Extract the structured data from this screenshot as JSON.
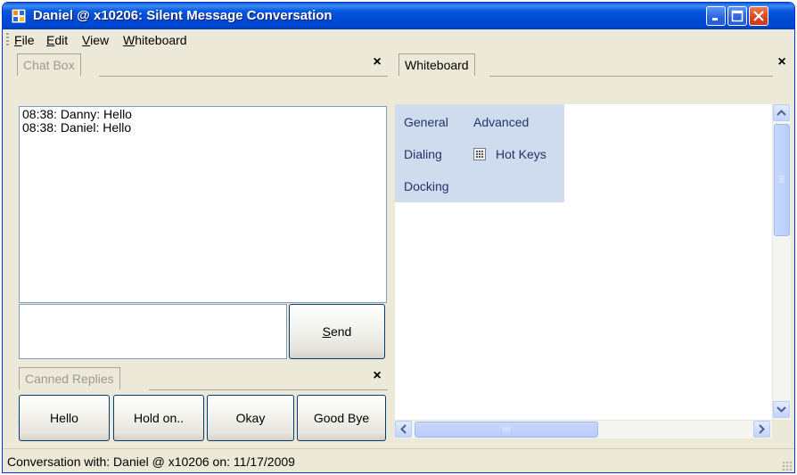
{
  "window": {
    "title": "Daniel @  x10206: Silent Message Conversation",
    "icons": {
      "app": "app-window-icon",
      "minimize": "minimize-icon",
      "maximize": "maximize-icon",
      "close": "close-icon"
    }
  },
  "menu": {
    "items": [
      {
        "label": "File",
        "accel": "F",
        "rest": "ile"
      },
      {
        "label": "Edit",
        "accel": "E",
        "rest": "dit"
      },
      {
        "label": "View",
        "accel": "V",
        "rest": "iew"
      },
      {
        "label": "Whiteboard",
        "accel": "W",
        "rest": "hiteboard"
      }
    ]
  },
  "chat_panel": {
    "tab_label": "Chat Box",
    "close_glyph": "×",
    "messages": [
      "08:38: Danny: Hello",
      "08:38: Daniel: Hello"
    ],
    "input_value": "",
    "send": {
      "accel": "S",
      "rest": "end",
      "label": "Send"
    }
  },
  "canned_panel": {
    "tab_label": "Canned Replies",
    "close_glyph": "×",
    "buttons": [
      "Hello",
      "Hold on..",
      "Okay",
      "Good Bye"
    ]
  },
  "whiteboard_panel": {
    "tab_label": "Whiteboard",
    "close_glyph": "×",
    "menu_items": {
      "general": "General",
      "advanced": "Advanced",
      "dialing": "Dialing",
      "hot_keys": "Hot Keys",
      "docking": "Docking"
    },
    "hot_keys_icon": "keypad-icon"
  },
  "status": {
    "text": "Conversation with: Daniel @  x10206 on: 11/17/2009"
  },
  "colors": {
    "title_bar": "#0049d4",
    "window_face": "#ece9d8",
    "menu_highlight": "#cfdcee",
    "close_button": "#d7451e"
  }
}
